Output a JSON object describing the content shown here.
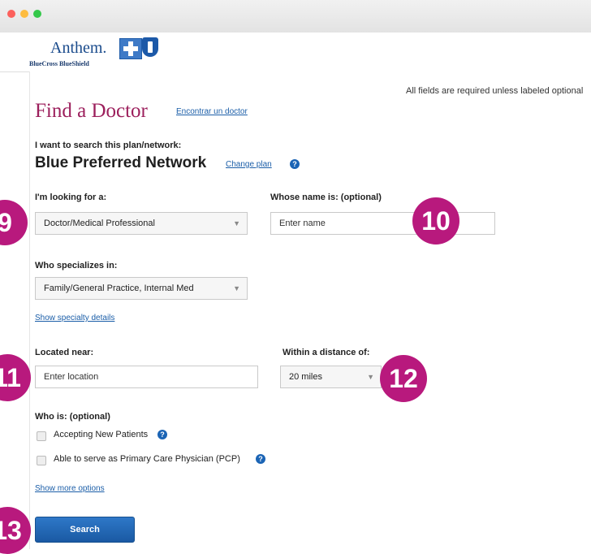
{
  "brand": {
    "name": "Anthem.",
    "sub": "BlueCross BlueShield"
  },
  "notice": "All fields are required unless labeled optional",
  "page": {
    "title": "Find a Doctor",
    "alt_language_link": "Encontrar un doctor"
  },
  "plan": {
    "label": "I want to search this plan/network:",
    "name": "Blue Preferred Network",
    "change_link": "Change plan",
    "help": "?"
  },
  "looking_for": {
    "label": "I'm looking for a:",
    "value": "Doctor/Medical Professional"
  },
  "name_field": {
    "label": "Whose name is: (optional)",
    "placeholder": "Enter name"
  },
  "specialty": {
    "label": "Who specializes in:",
    "value": "Family/General Practice, Internal Med",
    "details_link": "Show specialty details"
  },
  "location": {
    "label": "Located near:",
    "placeholder": "Enter location"
  },
  "distance": {
    "label": "Within a distance of:",
    "value": "20 miles"
  },
  "who_is": {
    "label": "Who is: (optional)",
    "options": [
      {
        "label": "Accepting New Patients",
        "help": "?"
      },
      {
        "label": "Able to serve as Primary Care Physician (PCP)",
        "help": "?"
      }
    ]
  },
  "more_options_link": "Show more options",
  "search_button": "Search",
  "badges": [
    "9",
    "10",
    "11",
    "12",
    "13"
  ],
  "colors": {
    "accent": "#9c1f5c",
    "badge": "#b8197d",
    "link": "#1b5ea8",
    "button": "#1f63b0"
  },
  "icons": {
    "caret": "chevron-down-icon",
    "help": "help-icon"
  }
}
